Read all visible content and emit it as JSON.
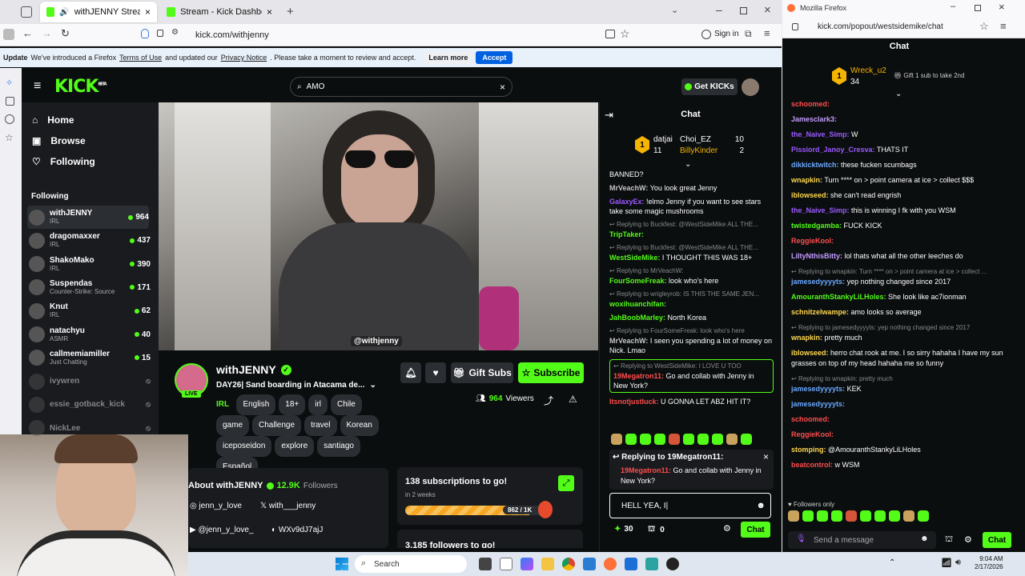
{
  "browser": {
    "tabs": [
      {
        "label": "withJENNY Stream - Watch",
        "active": true
      },
      {
        "label": "Stream - Kick Dashboard",
        "active": false
      }
    ],
    "url": "kick.com/withjenny",
    "sign_in": "Sign in",
    "notice": {
      "prefix": "Update",
      "text1": "We've introduced a Firefox",
      "link1": "Terms of Use",
      "text2": "and updated our",
      "link2": "Privacy Notice",
      "text3": ". Please take a moment to review and accept.",
      "learn_more": "Learn more",
      "accept": "Accept"
    }
  },
  "kick": {
    "logo": "KICK",
    "logo_sup": "BETA",
    "search_value": "AMO",
    "get_kicks": "Get KICKs",
    "nav": [
      {
        "label": "Home",
        "icon": "home-icon"
      },
      {
        "label": "Browse",
        "icon": "browse-icon"
      },
      {
        "label": "Following",
        "icon": "heart-icon"
      }
    ],
    "following_header": "Following",
    "following": [
      {
        "name": "withJENNY",
        "cat": "IRL",
        "count": "964",
        "live": true
      },
      {
        "name": "dragomaxxer",
        "cat": "IRL",
        "count": "437",
        "live": true
      },
      {
        "name": "ShakoMako",
        "cat": "IRL",
        "count": "390",
        "live": true
      },
      {
        "name": "Suspendas",
        "cat": "Counter-Strike: Source",
        "count": "171",
        "live": true
      },
      {
        "name": "Knut",
        "cat": "IRL",
        "count": "62",
        "live": true
      },
      {
        "name": "natachyu",
        "cat": "ASMR",
        "count": "40",
        "live": true
      },
      {
        "name": "callmemiamiller",
        "cat": "Just Chatting",
        "count": "15",
        "live": true
      },
      {
        "name": "ivywren",
        "cat": "",
        "count": "",
        "live": false
      },
      {
        "name": "essie_gotback_kick",
        "cat": "",
        "count": "",
        "live": false
      },
      {
        "name": "NickLee",
        "cat": "",
        "count": "",
        "live": false
      }
    ],
    "stream": {
      "watermark": "@withjenny",
      "channel": "withJENNY",
      "live_badge": "LIVE",
      "title": "DAY26| Sand boarding in Atacama de...",
      "category": "IRL",
      "tags": [
        "English",
        "18+",
        "irl",
        "Chile",
        "game",
        "Challenge",
        "travel",
        "Korean",
        "iceposeidon",
        "explore",
        "santiago",
        "Español"
      ],
      "viewers": "964",
      "viewers_label": "Viewers",
      "gift_subs": "Gift Subs",
      "subscribe": "Subscribe"
    },
    "about": {
      "title": "About withJENNY",
      "followers": "12.9K",
      "followers_label": "Followers",
      "socials": [
        {
          "icon": "instagram-icon",
          "text": "jenn_y_love"
        },
        {
          "icon": "x-icon",
          "text": "with___jenny"
        },
        {
          "icon": "youtube-icon",
          "text": "@jenn_y_love_"
        },
        {
          "icon": "discord-icon",
          "text": "WXv9dJ7ajJ"
        }
      ]
    },
    "goal": {
      "title": "138 subscriptions to go!",
      "subtitle": "in 2 weeks",
      "progress_text": "862 / 1K",
      "progress": 0.862,
      "cut_text": "3,185 followers to go!"
    },
    "chat": {
      "header": "Chat",
      "leaders": [
        {
          "name": "datjai",
          "count": "11"
        },
        {
          "name": "Choi_EZ",
          "count": "10"
        },
        {
          "name": "BillyKinder",
          "count": "2"
        }
      ],
      "messages": [
        {
          "reply": "",
          "user": "",
          "text": "BANNED?",
          "color": "#fff"
        },
        {
          "reply": "",
          "user": "MrVeachW:",
          "text": "You look great Jenny",
          "color": "#c5c5c5"
        },
        {
          "reply": "",
          "user": "GalaxyEx:",
          "text": "!elmo Jenny if you want to see stars take some magic mushrooms",
          "color": "#9b59ff"
        },
        {
          "reply": "Replying to Buckfest: @WestSideMike ALL THE...",
          "user": "TripTaker:",
          "text": "",
          "color": "#53fc18"
        },
        {
          "reply": "Replying to Buckfest: @WestSideMike ALL THE...",
          "user": "WestSideMike:",
          "text": "I THOUGHT THIS WAS 18+",
          "color": "#53fc18"
        },
        {
          "reply": "Replying to MrVeachW:",
          "user": "FourSomeFreak:",
          "text": "look who's here",
          "color": "#53fc18"
        },
        {
          "reply": "Replying to wrigleyrob: IS THIS THE SAME JEN...",
          "user": "woxihuanchifan:",
          "text": "",
          "color": "#53fc18"
        },
        {
          "reply": "",
          "user": "JahBoobMarley:",
          "text": "North Korea",
          "color": "#53fc18"
        },
        {
          "reply": "Replying to FourSomeFreak: look who's here",
          "user": "MrVeachW:",
          "text": "I seen you spending a lot of money on Nick. Lmao",
          "color": "#c5c5c5"
        },
        {
          "reply": "Replying to WestSideMike: I LOVE U TOO",
          "user": "19Megatron11:",
          "text": "Go and collab with Jenny in New York?",
          "color": "#ff4d4d",
          "highlight": true
        },
        {
          "reply": "",
          "user": "Itsnotjustluck:",
          "text": "U GONNA LET ABZ HIT IT?",
          "color": "#ff4d4d"
        }
      ],
      "replying_to": "Replying to 19Megatron11:",
      "reply_user": "19Megatron11:",
      "reply_text": "Go and collab with Jenny in New York?",
      "input_value": "HELL YEA, I",
      "points": "30",
      "drops": "0",
      "send": "Chat"
    }
  },
  "popout": {
    "window_title": "Mozilla Firefox",
    "url": "kick.com/popout/westsidemike/chat",
    "header": "Chat",
    "top_user": "Wreck_u2",
    "top_count": "34",
    "gift_text": "Gift 1 sub to take 2nd",
    "messages": [
      {
        "reply": "",
        "user": "schoomed:",
        "text": "",
        "color": "#ff4d4d"
      },
      {
        "reply": "",
        "user": "Jamesclark3:",
        "text": "",
        "color": "#c39bff"
      },
      {
        "reply": "",
        "user": "the_Naive_Simp:",
        "text": "W",
        "color": "#9b59ff"
      },
      {
        "reply": "",
        "user": "Pissiord_Janoy_Cresva:",
        "text": "THATS IT",
        "color": "#9b59ff"
      },
      {
        "reply": "",
        "user": "dikkicktwitch:",
        "text": "these fucken scumbags",
        "color": "#6aa8ff"
      },
      {
        "reply": "",
        "user": "wnapkin:",
        "text": "Turn **** on > point camera at ice > collect $$$",
        "color": "#ffd84d"
      },
      {
        "reply": "",
        "user": "iblowseed:",
        "text": "she can't read engrish",
        "color": "#ffd84d"
      },
      {
        "reply": "",
        "user": "the_Naive_Simp:",
        "text": "this is winning I fk with you WSM",
        "color": "#9b59ff"
      },
      {
        "reply": "",
        "user": "twistedgamba:",
        "text": "FUCK KICK",
        "color": "#53fc18"
      },
      {
        "reply": "",
        "user": "ReggieKool:",
        "text": "",
        "color": "#ff4d4d"
      },
      {
        "reply": "",
        "user": "LiltyNthisBitty:",
        "text": "lol thats what all the other leeches do",
        "color": "#c39bff"
      },
      {
        "reply": "Replying to wnapkin: Turn **** on > point camera at ice > collect ...",
        "user": "jamesedyyyyts:",
        "text": "yep nothing changed since 2017",
        "color": "#6aa8ff"
      },
      {
        "reply": "",
        "user": "AmouranthStankyLiLHoles:",
        "text": "She look like ac7ionman",
        "color": "#53fc18"
      },
      {
        "reply": "",
        "user": "schnitzelwampe:",
        "text": "amo looks so average",
        "color": "#ffd84d"
      },
      {
        "reply": "Replying to jamesedyyyyts: yep nothing changed since 2017",
        "user": "wnapkin:",
        "text": "pretty much",
        "color": "#ffd84d"
      },
      {
        "reply": "",
        "user": "iblowseed:",
        "text": "herro chat rook at me. I so sirry hahaha I have my sun grasses on top of my head hahaha me so funny",
        "color": "#ffd84d"
      },
      {
        "reply": "Replying to wnapkin: pretty much",
        "user": "jamesedyyyyts:",
        "text": "KEK",
        "color": "#6aa8ff"
      },
      {
        "reply": "",
        "user": "jamesedyyyyts:",
        "text": "",
        "color": "#6aa8ff"
      },
      {
        "reply": "",
        "user": "schoomed:",
        "text": "",
        "color": "#ff4d4d"
      },
      {
        "reply": "",
        "user": "ReggieKool:",
        "text": "",
        "color": "#ff4d4d"
      },
      {
        "reply": "",
        "user": "stomping:",
        "text": "@AmouranthStankyLiLHoles",
        "color": "#ffd84d"
      },
      {
        "reply": "",
        "user": "beatcontrol:",
        "text": "w WSM",
        "color": "#ff4d4d"
      }
    ],
    "followers_only": "Followers only",
    "placeholder": "Send a message",
    "send": "Chat"
  },
  "taskbar": {
    "search": "Search",
    "time": "9:04 AM",
    "date": "2/17/2026"
  },
  "colors": {
    "kick_green": "#53fc18",
    "bg": "#0b0e0f"
  }
}
